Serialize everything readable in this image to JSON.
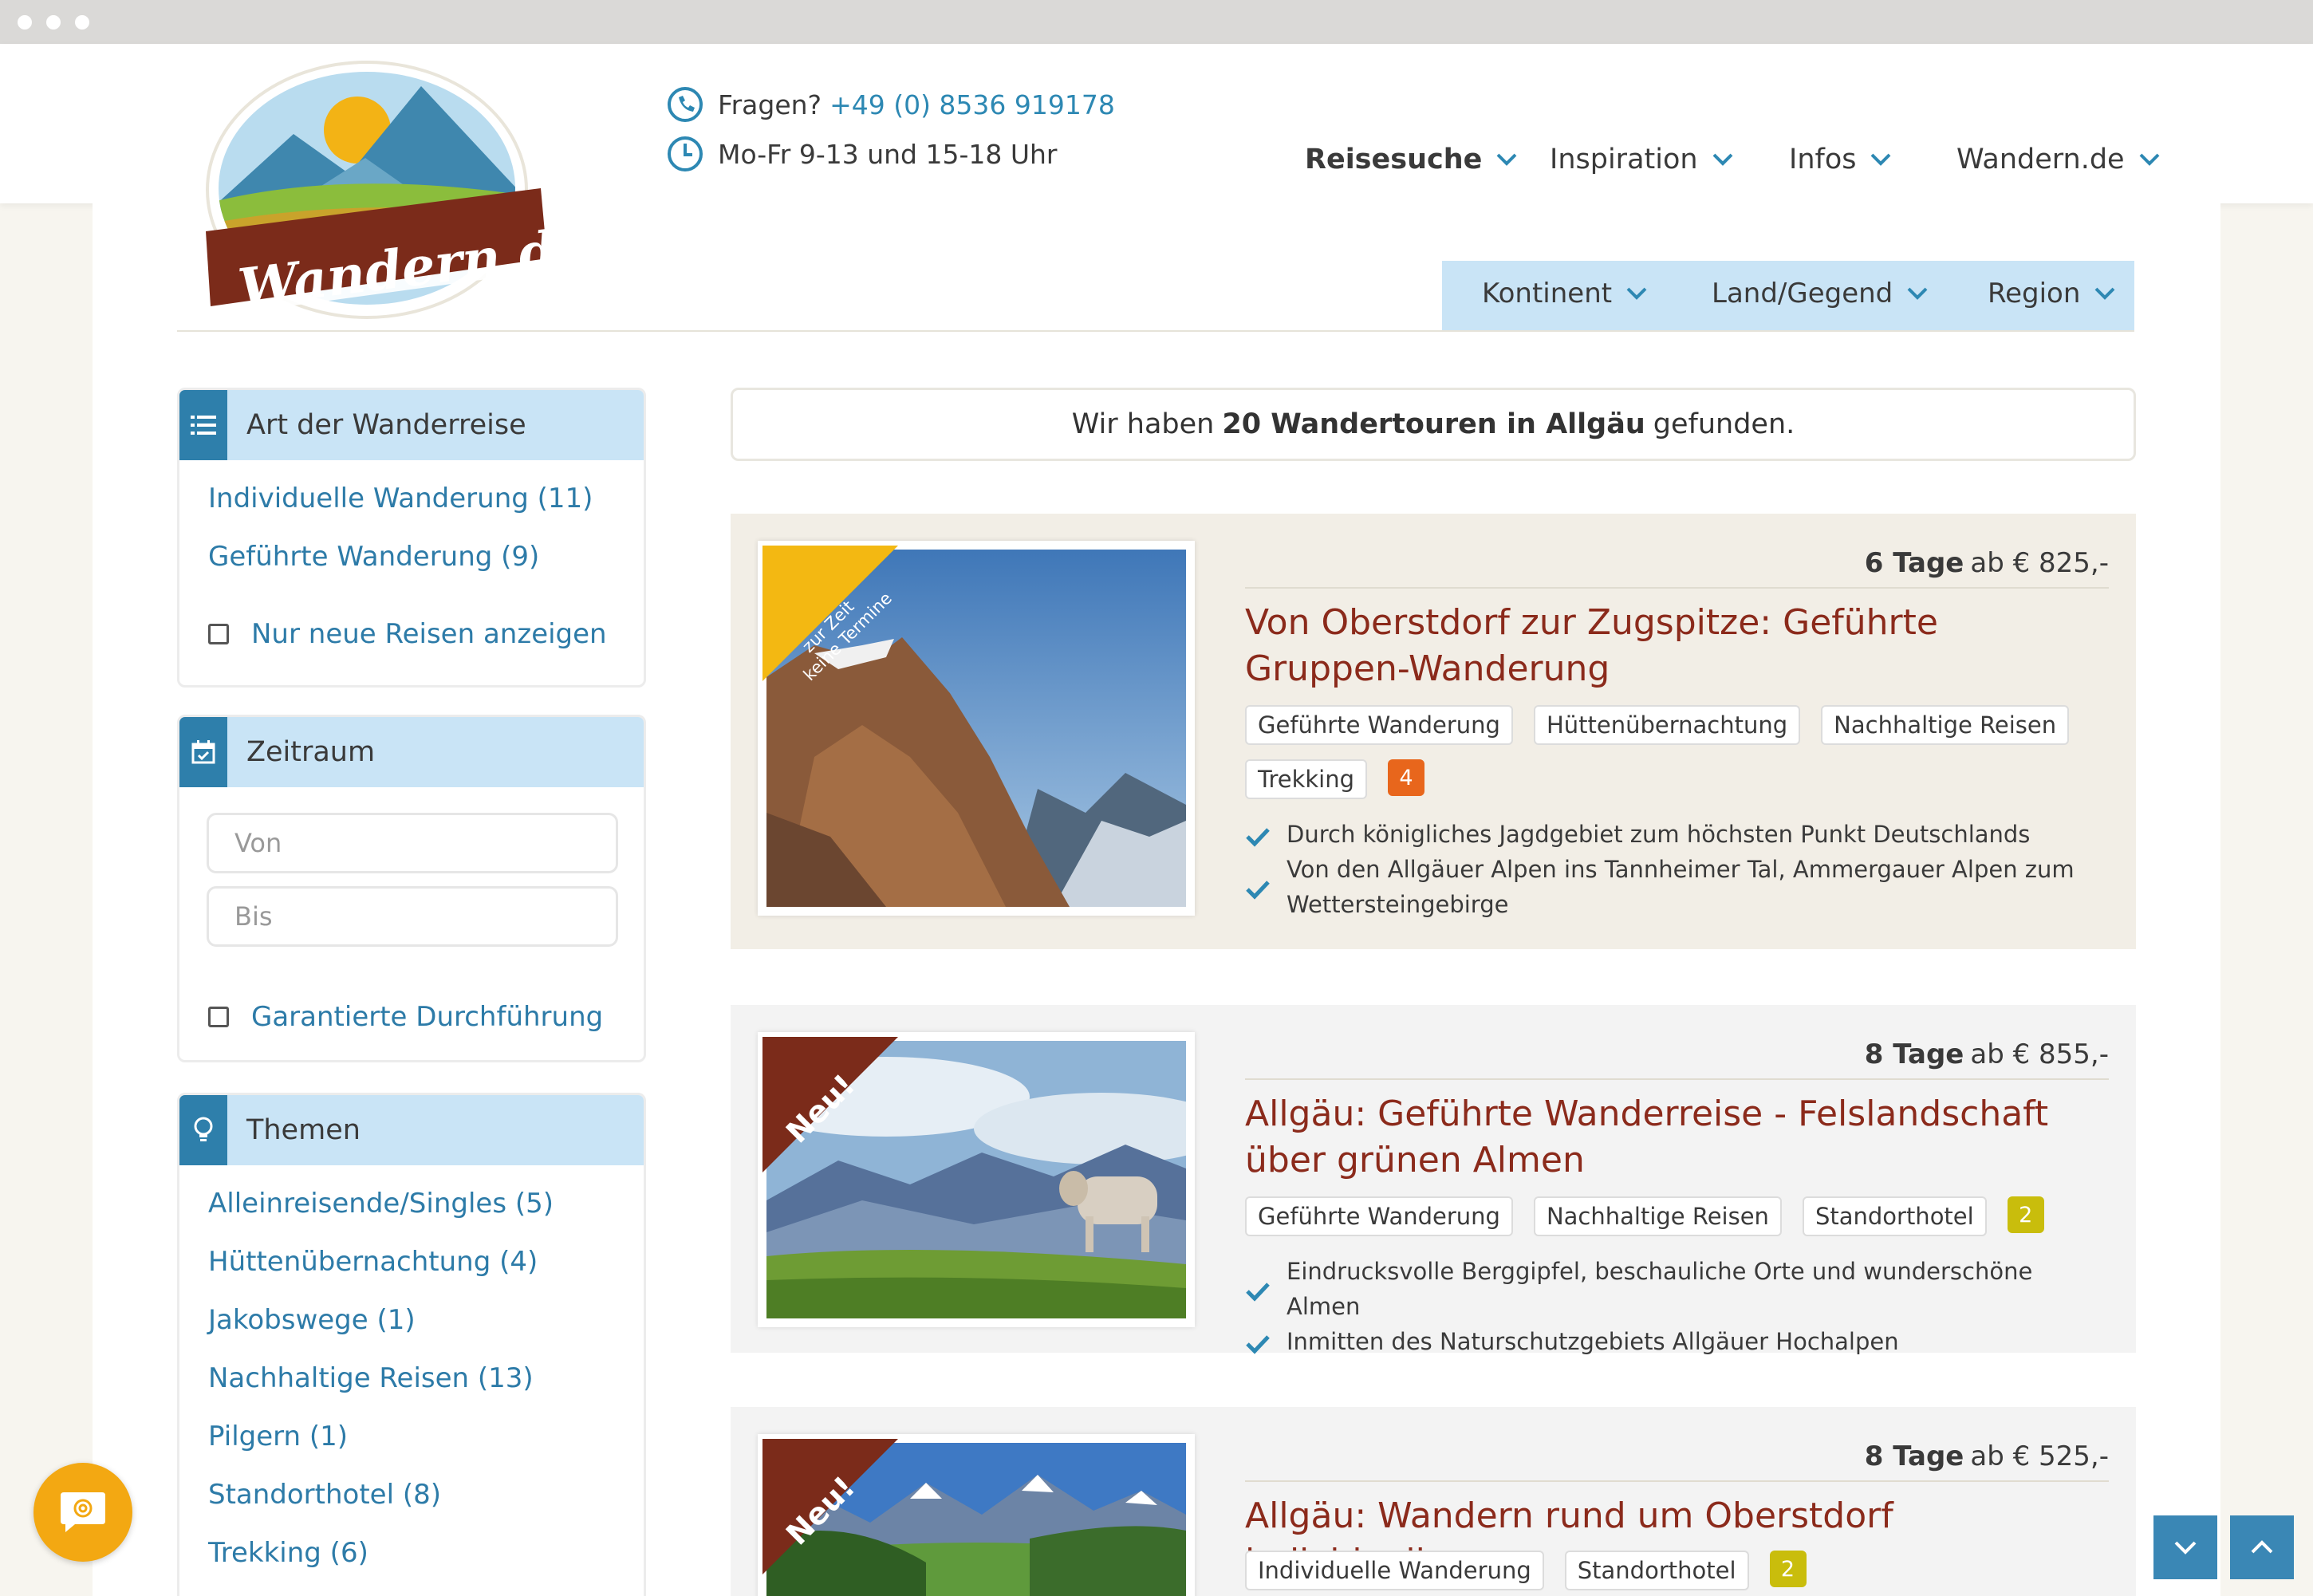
{
  "brand": {
    "name": "Wandern.de"
  },
  "contact": {
    "question_label": "Fragen?",
    "phone": "+49 (0) 8536 919178",
    "hours": "Mo-Fr 9-13 und 15-18 Uhr"
  },
  "nav": [
    {
      "label": "Reisesuche"
    },
    {
      "label": "Inspiration"
    },
    {
      "label": "Infos"
    },
    {
      "label": "Wandern.de"
    }
  ],
  "subnav": [
    {
      "label": "Kontinent"
    },
    {
      "label": "Land/Gegend"
    },
    {
      "label": "Region"
    }
  ],
  "filters": {
    "type": {
      "title": "Art der Wanderreise",
      "options": [
        "Individuelle Wanderung (11)",
        "Geführte Wanderung (9)"
      ],
      "checkbox": "Nur neue Reisen anzeigen"
    },
    "period": {
      "title": "Zeitraum",
      "from_placeholder": "Von",
      "to_placeholder": "Bis",
      "checkbox": "Garantierte Durchführung"
    },
    "themes": {
      "title": "Themen",
      "options": [
        "Alleinreisende/Singles (5)",
        "Hüttenübernachtung (4)",
        "Jakobswege (1)",
        "Nachhaltige Reisen (13)",
        "Pilgern (1)",
        "Standorthotel (8)",
        "Trekking (6)"
      ]
    }
  },
  "results": {
    "prefix": "Wir haben",
    "highlight": "20 Wandertouren in Allgäu",
    "suffix": "gefunden."
  },
  "tours": [
    {
      "ribbon": "zur Zeit keine Termine",
      "days": "6 Tage",
      "price": "ab € 825,-",
      "title": "Von Oberstdorf zur Zugspitze: Geführte Gruppen-Wanderung",
      "tags": [
        "Geführte Wanderung",
        "Hüttenübernachtung",
        "Nachhaltige Reisen",
        "Trekking"
      ],
      "level": "4",
      "level_color": "#e8661c",
      "bullets": [
        "Durch königliches Jagdgebiet zum höchsten Punkt Deutschlands",
        "Von den Allgäuer Alpen ins Tannheimer Tal, Ammergauer Alpen zum Wettersteingebirge"
      ]
    },
    {
      "ribbon": "Neu!",
      "days": "8 Tage",
      "price": "ab € 855,-",
      "title": "Allgäu: Geführte Wanderreise - Felslandschaft über grünen Almen",
      "tags": [
        "Geführte Wanderung",
        "Nachhaltige Reisen",
        "Standorthotel"
      ],
      "level": "2",
      "level_color": "#c9bd0c",
      "bullets": [
        "Eindrucksvolle Berggipfel, beschauliche Orte und wunderschöne Almen",
        "Inmitten des Naturschutzgebiets Allgäuer Hochalpen"
      ]
    },
    {
      "ribbon": "Neu!",
      "days": "8 Tage",
      "price": "ab € 525,-",
      "title": "Allgäu: Wandern rund um Oberstdorf individuell",
      "tags": [
        "Individuelle Wanderung",
        "Standorthotel"
      ],
      "level": "2",
      "level_color": "#c9bd0c",
      "bullets": []
    }
  ]
}
